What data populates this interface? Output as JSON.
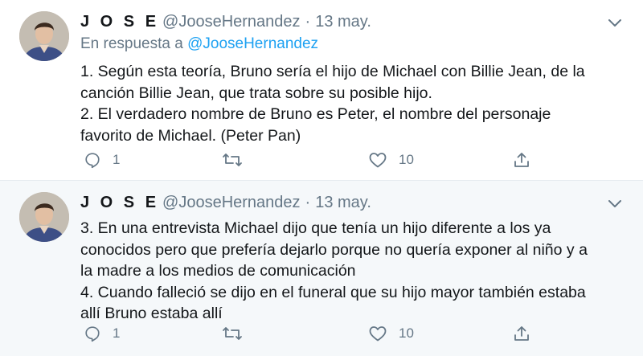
{
  "tweets": [
    {
      "display_name": "J O S E",
      "handle": "@JooseHernandez",
      "separator": "·",
      "date": "13 may.",
      "reply_prefix": "En respuesta a",
      "reply_mention": "@JooseHernandez",
      "text": "1. Según esta teoría, Bruno sería el hijo de Michael con Billie Jean, de la\ncanción Billie Jean, que trata sobre su posible hijo.\n2. El verdadero nombre de Bruno es Peter, el nombre del personaje\nfavorito de Michael. (Peter Pan)",
      "reply_count": "1",
      "retweet_count": "",
      "like_count": "10"
    },
    {
      "display_name": "J O S E",
      "handle": "@JooseHernandez",
      "separator": "·",
      "date": "13 may.",
      "text": "3. En una entrevista Michael dijo que tenía un hijo diferente a los ya\nconocidos pero que prefería dejarlo porque no quería exponer al niño y a\nla madre a los medios de comunicación\n4. Cuando falleció se dijo en el funeral que su hijo mayor también estaba\nallí Bruno estaba allí",
      "reply_count": "1",
      "retweet_count": "",
      "like_count": "10"
    }
  ],
  "icons": {
    "reply": "reply-icon",
    "retweet": "retweet-icon",
    "like": "heart-icon",
    "share": "share-icon",
    "more": "chevron-down-icon"
  },
  "colors": {
    "text": "#14171a",
    "secondary": "#657786",
    "link": "#1da1f2",
    "highlight_bg": "#f5f8fa"
  }
}
